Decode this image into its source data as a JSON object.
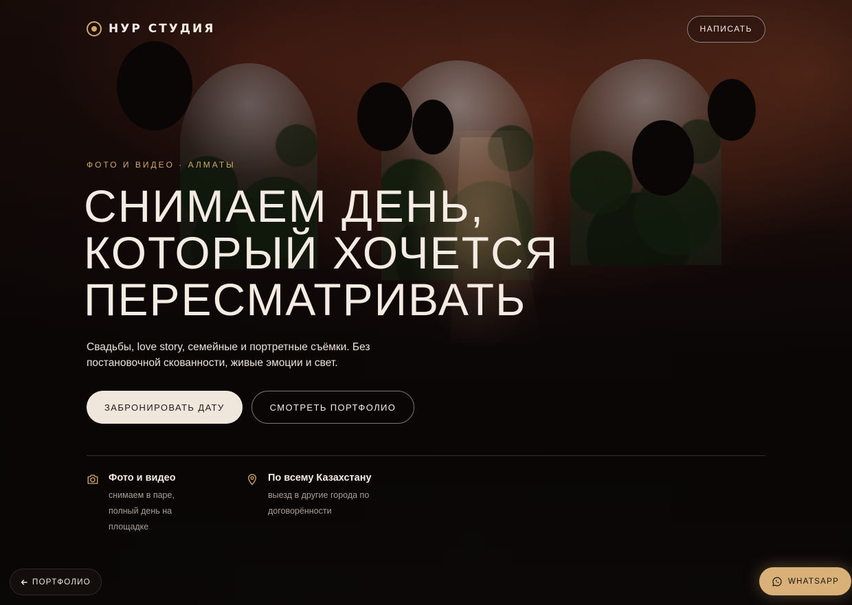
{
  "header": {
    "brand": "НУР СТУДИЯ",
    "write_label": "НАПИСАТЬ"
  },
  "hero": {
    "eyebrow": "ФОТО И ВИДЕО · АЛМАТЫ",
    "headline": [
      "СНИМАЕМ ДЕНЬ,",
      "КОТОРЫЙ ХОЧЕТСЯ",
      "ПЕРЕСМАТРИВАТЬ"
    ],
    "lead": "Свадьбы, love story, семейные и портретные съёмки. Без постановочной скованности, живые эмоции и свет.",
    "cta_primary": "ЗАБРОНИРОВАТЬ ДАТУ",
    "cta_secondary": "СМОТРЕТЬ ПОРТФОЛИО"
  },
  "features": [
    {
      "icon": "camera-icon",
      "title": "Фото и видео",
      "text": "снимаем в паре, полный день на площадке"
    },
    {
      "icon": "map-pin-icon",
      "title": "По всему Казахстану",
      "text": "выезд в другие города по договорённости"
    }
  ],
  "floating": {
    "back_label": "ПОРТФОЛИО",
    "whatsapp_label": "WHATSAPP"
  },
  "colors": {
    "accent": "#d2a86a",
    "background": "#0d0909",
    "text": "#f4ece3",
    "whatsapp_bg": "#d8b078"
  }
}
